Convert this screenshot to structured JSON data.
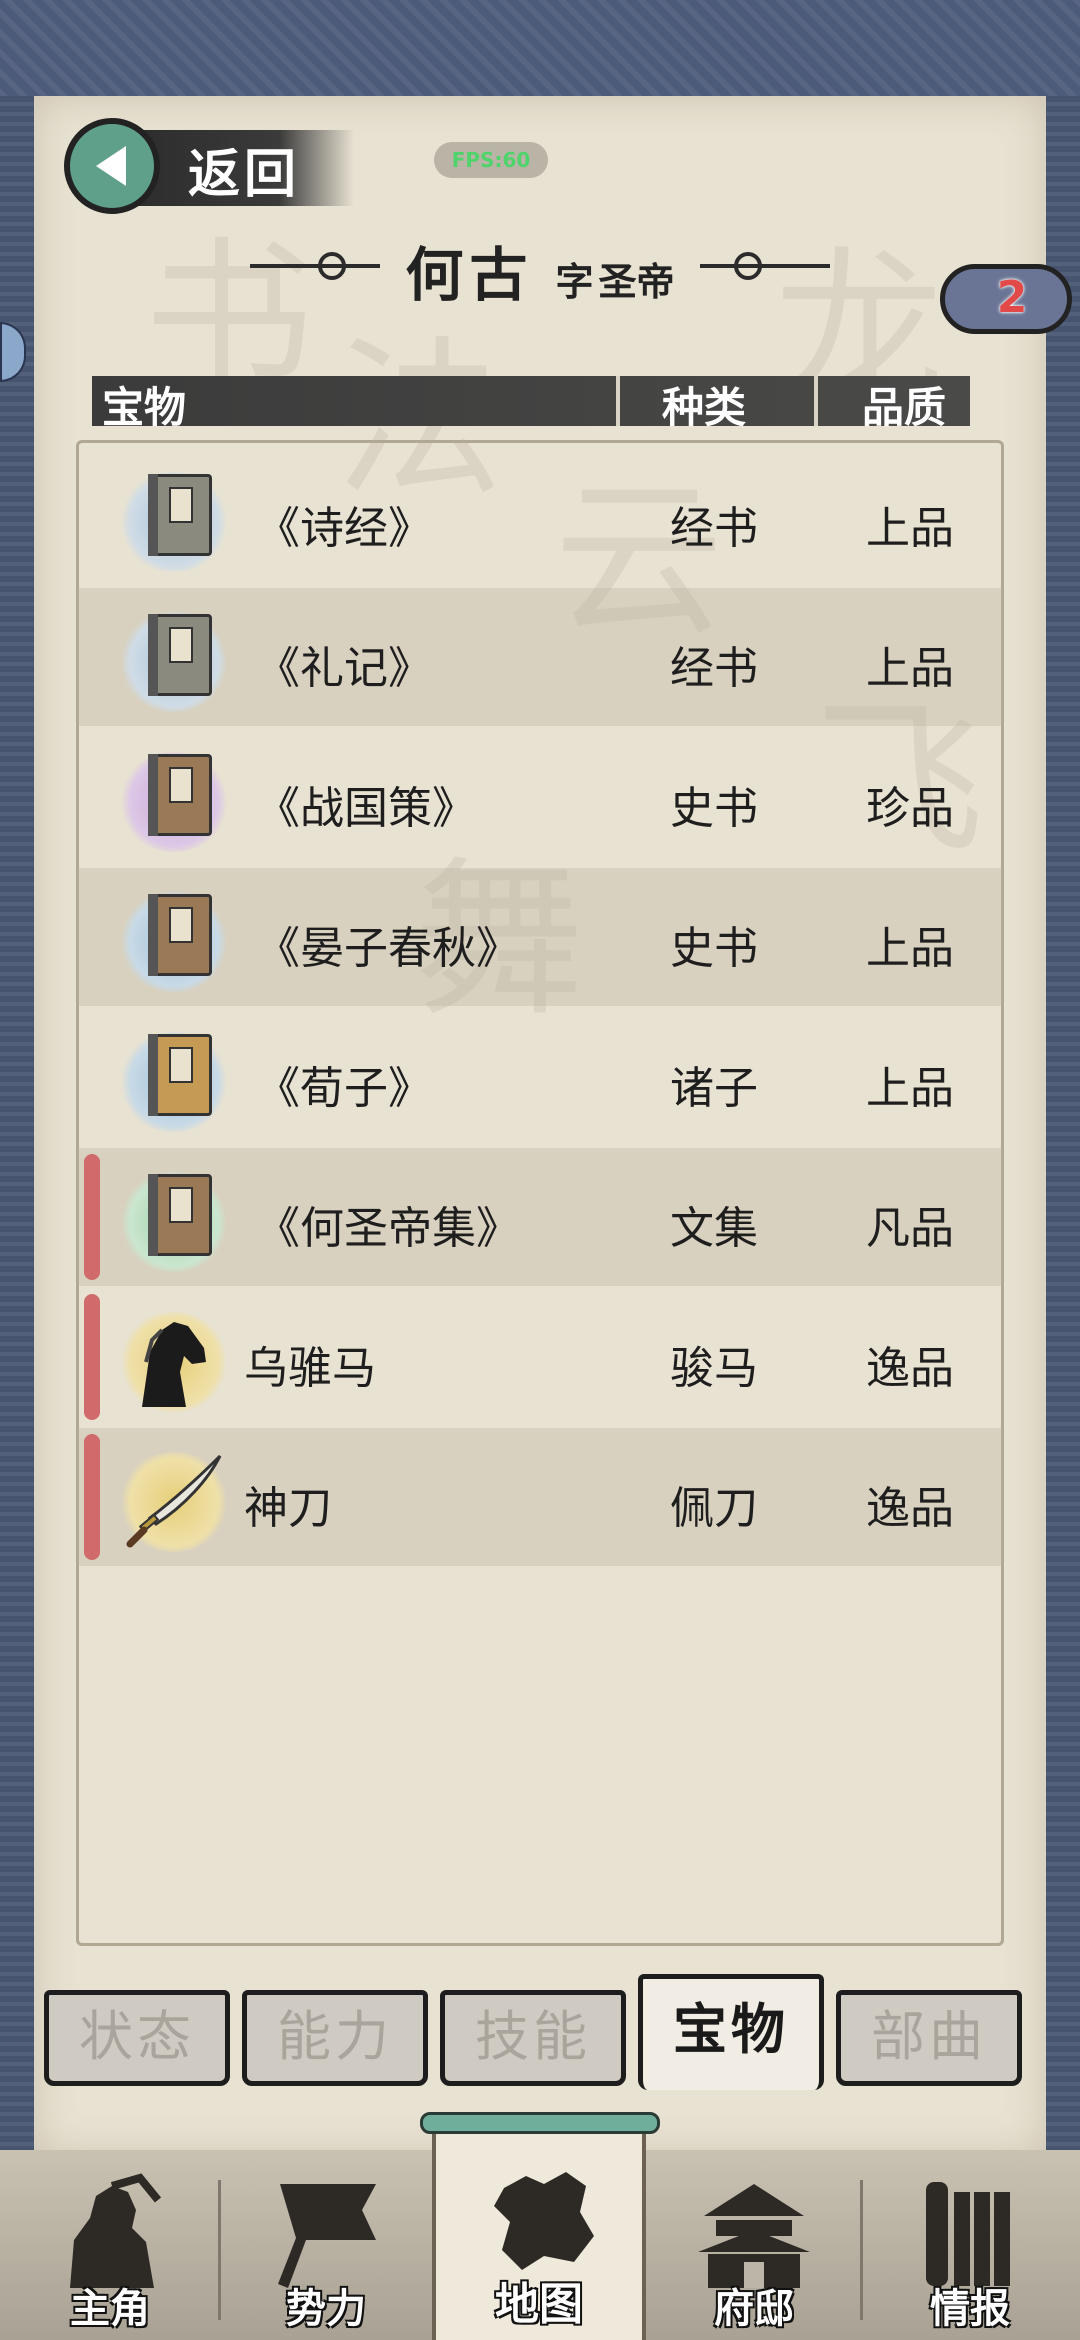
{
  "header": {
    "back_label": "返回",
    "fps_label": "FPS:60"
  },
  "title": {
    "name": "何古",
    "zi_label": "字",
    "style_name": "圣帝"
  },
  "badge": {
    "count": "2"
  },
  "table": {
    "columns": [
      "宝物",
      "种类",
      "品质"
    ],
    "rows": [
      {
        "name": "《诗经》",
        "type": "经书",
        "quality": "上品",
        "icon": "book-icon",
        "marked": false
      },
      {
        "name": "《礼记》",
        "type": "经书",
        "quality": "上品",
        "icon": "book-icon",
        "marked": false
      },
      {
        "name": "《战国策》",
        "type": "史书",
        "quality": "珍品",
        "icon": "book-icon",
        "marked": false
      },
      {
        "name": "《晏子春秋》",
        "type": "史书",
        "quality": "上品",
        "icon": "book-icon",
        "marked": false
      },
      {
        "name": "《荀子》",
        "type": "诸子",
        "quality": "上品",
        "icon": "book-icon",
        "marked": false
      },
      {
        "name": "《何圣帝集》",
        "type": "文集",
        "quality": "凡品",
        "icon": "book-icon",
        "marked": true
      },
      {
        "name": "乌骓马",
        "type": "骏马",
        "quality": "逸品",
        "icon": "horse-icon",
        "marked": true
      },
      {
        "name": "神刀",
        "type": "佩刀",
        "quality": "逸品",
        "icon": "sword-icon",
        "marked": true
      }
    ]
  },
  "tabs": [
    {
      "label": "状态",
      "active": false
    },
    {
      "label": "能力",
      "active": false
    },
    {
      "label": "技能",
      "active": false
    },
    {
      "label": "宝物",
      "active": true
    },
    {
      "label": "部曲",
      "active": false
    }
  ],
  "bottom_nav": [
    {
      "label": "主角",
      "icon": "warrior-icon"
    },
    {
      "label": "势力",
      "icon": "flag-icon"
    },
    {
      "label": "地图",
      "icon": "map-icon",
      "active": true
    },
    {
      "label": "府邸",
      "icon": "mansion-icon"
    },
    {
      "label": "情报",
      "icon": "scroll-icon"
    }
  ],
  "colors": {
    "frame": "#46546f",
    "paper": "#e8e2d2",
    "marker": "#d16a6a",
    "back_button": "#5fa08a",
    "badge_number": "#e24a4a"
  }
}
